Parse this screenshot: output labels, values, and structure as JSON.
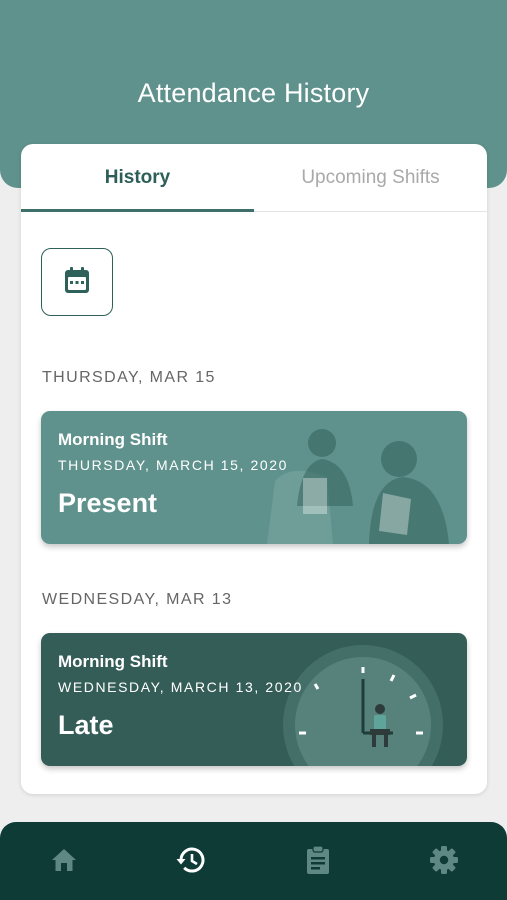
{
  "header": {
    "title": "Attendance History"
  },
  "tabs": [
    {
      "label": "History",
      "active": true
    },
    {
      "label": "Upcoming Shifts",
      "active": false
    }
  ],
  "calendar_button": {
    "icon": "calendar-icon"
  },
  "sections": [
    {
      "heading": "THURSDAY, MAR 15",
      "shift": {
        "name": "Morning Shift",
        "date": "THURSDAY, MARCH 15, 2020",
        "status": "Present",
        "color": "#5f928c"
      }
    },
    {
      "heading": "WEDNESDAY, MAR 13",
      "shift": {
        "name": "Morning Shift",
        "date": "WEDNESDAY, MARCH 13, 2020",
        "status": "Late",
        "color": "#355d58"
      }
    }
  ],
  "bottom_nav": [
    {
      "icon": "home-icon",
      "active": false
    },
    {
      "icon": "history-icon",
      "active": true
    },
    {
      "icon": "clipboard-icon",
      "active": false
    },
    {
      "icon": "gear-icon",
      "active": false
    }
  ],
  "colors": {
    "primary": "#5f928c",
    "primary_dark": "#355d58",
    "nav_bg": "#0e3b36",
    "accent_text": "#2d5f58"
  }
}
